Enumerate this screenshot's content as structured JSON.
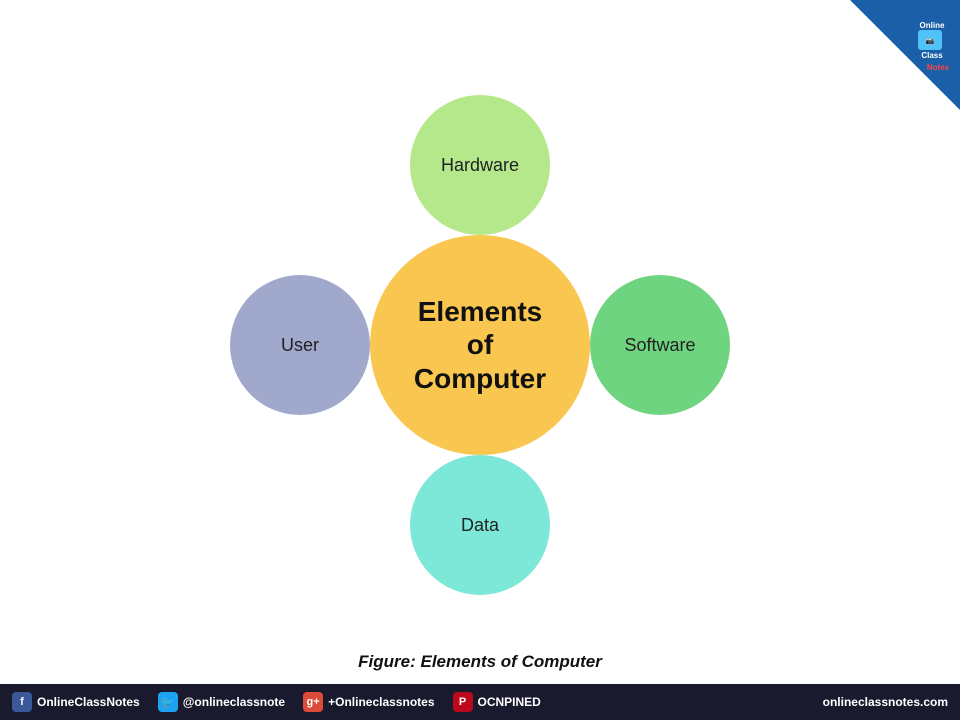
{
  "diagram": {
    "center_label": "Elements\nof\nComputer",
    "top_label": "Hardware",
    "right_label": "Software",
    "bottom_label": "Data",
    "left_label": "User"
  },
  "caption": "Figure: Elements of Computer",
  "badge": {
    "line1": "Online",
    "line2": "Class",
    "line3": "Notes"
  },
  "bottomBar": {
    "items": [
      {
        "icon": "f",
        "iconType": "fb",
        "text": "OnlineClassNotes"
      },
      {
        "icon": "🐦",
        "iconType": "tw",
        "text": "@onlineclassnote"
      },
      {
        "icon": "g+",
        "iconType": "gp",
        "text": "+Onlineclassnotes"
      },
      {
        "icon": "P",
        "iconType": "pi",
        "text": "OCNPINED"
      }
    ],
    "url": "onlineclassnotes.com"
  }
}
